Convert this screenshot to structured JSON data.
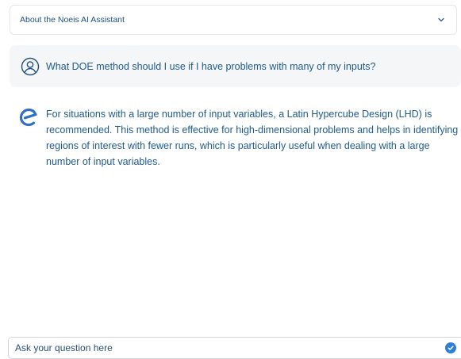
{
  "accordion": {
    "title": "About the Noeis AI Assistant",
    "icon": "chevron-down-icon"
  },
  "user_message": {
    "avatar_icon": "user-circle-icon",
    "text": "What DOE method should I use if I have problems with many of my inputs?"
  },
  "assistant_message": {
    "avatar_icon": "noeis-logo-icon",
    "text": "For situations with a large number of input variables, a Latin Hypercube Design (LHD) is recommended. This method is effective for high-dimensional problems and helps in identifying regions of interest with fewer runs, which is particularly useful when dealing with a large number of input variables."
  },
  "chat_input": {
    "placeholder": "Ask your question here",
    "value": "",
    "send_icon": "check-circle-icon"
  },
  "colors": {
    "text_primary": "#1f5a8a",
    "accent": "#2f7fd6",
    "user_bubble": "#f4f6f8"
  }
}
